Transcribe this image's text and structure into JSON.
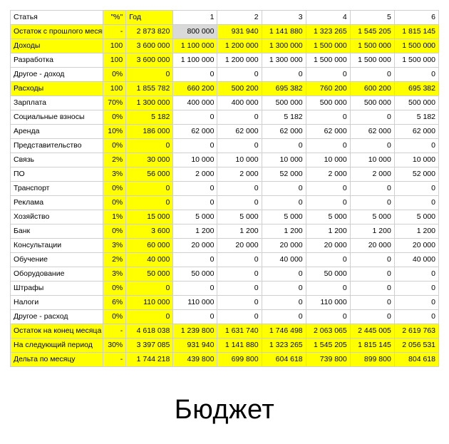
{
  "title": "Бюджет",
  "colors": {
    "highlight": "#ffff00",
    "selected_cell": "#d9d9d9",
    "grid_line": "#cfcfcf",
    "background": "#ffffff",
    "text": "#000000"
  },
  "table": {
    "columns": [
      {
        "key": "item",
        "label": "Статья",
        "align": "left"
      },
      {
        "key": "pct",
        "label": "\"%\"",
        "align": "right",
        "highlight": true
      },
      {
        "key": "year",
        "label": "Год",
        "align": "left",
        "highlight": true
      },
      {
        "key": "m1",
        "label": "1",
        "align": "right"
      },
      {
        "key": "m2",
        "label": "2",
        "align": "right"
      },
      {
        "key": "m3",
        "label": "3",
        "align": "right"
      },
      {
        "key": "m4",
        "label": "4",
        "align": "right"
      },
      {
        "key": "m5",
        "label": "5",
        "align": "right"
      },
      {
        "key": "m6",
        "label": "6",
        "align": "right"
      }
    ],
    "rows": [
      {
        "item": "Остаток с прошлого месяц",
        "pct": "-",
        "year": "2 873 820",
        "months": [
          "800 000",
          "931 940",
          "1 141 880",
          "1 323 265",
          "1 545 205",
          "1 815 145"
        ],
        "row_fill": "yellow",
        "month_fills": [
          "gray",
          "yellow",
          "yellow",
          "yellow",
          "yellow",
          "yellow"
        ]
      },
      {
        "item": "Доходы",
        "pct": "100",
        "year": "3 600 000",
        "months": [
          "1 100 000",
          "1 200 000",
          "1 300 000",
          "1 500 000",
          "1 500 000",
          "1 500 000"
        ],
        "row_fill": "yellow",
        "month_fills": [
          "yellow",
          "yellow",
          "yellow",
          "yellow",
          "yellow",
          "yellow"
        ]
      },
      {
        "item": "Разработка",
        "pct": "100",
        "year": "3 600 000",
        "months": [
          "1 100 000",
          "1 200 000",
          "1 300 000",
          "1 500 000",
          "1 500 000",
          "1 500 000"
        ],
        "row_fill": "white",
        "month_fills": [
          "white",
          "white",
          "white",
          "white",
          "white",
          "white"
        ]
      },
      {
        "item": "Другое - доход",
        "pct": "0%",
        "year": "0",
        "months": [
          "0",
          "0",
          "0",
          "0",
          "0",
          "0"
        ],
        "row_fill": "white",
        "month_fills": [
          "white",
          "white",
          "white",
          "white",
          "white",
          "white"
        ]
      },
      {
        "item": "Расходы",
        "pct": "100",
        "year": "1 855 782",
        "months": [
          "660 200",
          "500 200",
          "695 382",
          "760 200",
          "600 200",
          "695 382"
        ],
        "row_fill": "yellow",
        "month_fills": [
          "yellow",
          "yellow",
          "yellow",
          "yellow",
          "yellow",
          "yellow"
        ]
      },
      {
        "item": "Зарплата",
        "pct": "70%",
        "year": "1 300 000",
        "months": [
          "400 000",
          "400 000",
          "500 000",
          "500 000",
          "500 000",
          "500 000"
        ],
        "row_fill": "white",
        "month_fills": [
          "white",
          "white",
          "white",
          "white",
          "white",
          "white"
        ]
      },
      {
        "item": "Социальные взносы",
        "pct": "0%",
        "year": "5 182",
        "months": [
          "0",
          "0",
          "5 182",
          "0",
          "0",
          "5 182"
        ],
        "row_fill": "white",
        "month_fills": [
          "white",
          "white",
          "white",
          "white",
          "white",
          "white"
        ]
      },
      {
        "item": "Аренда",
        "pct": "10%",
        "year": "186 000",
        "months": [
          "62 000",
          "62 000",
          "62 000",
          "62 000",
          "62 000",
          "62 000"
        ],
        "row_fill": "white",
        "month_fills": [
          "white",
          "white",
          "white",
          "white",
          "white",
          "white"
        ]
      },
      {
        "item": "Представительство",
        "pct": "0%",
        "year": "0",
        "months": [
          "0",
          "0",
          "0",
          "0",
          "0",
          "0"
        ],
        "row_fill": "white",
        "month_fills": [
          "white",
          "white",
          "white",
          "white",
          "white",
          "white"
        ]
      },
      {
        "item": "Связь",
        "pct": "2%",
        "year": "30 000",
        "months": [
          "10 000",
          "10 000",
          "10 000",
          "10 000",
          "10 000",
          "10 000"
        ],
        "row_fill": "white",
        "month_fills": [
          "white",
          "white",
          "white",
          "white",
          "white",
          "white"
        ]
      },
      {
        "item": "ПО",
        "pct": "3%",
        "year": "56 000",
        "months": [
          "2 000",
          "2 000",
          "52 000",
          "2 000",
          "2 000",
          "52 000"
        ],
        "row_fill": "white",
        "month_fills": [
          "white",
          "white",
          "white",
          "white",
          "white",
          "white"
        ]
      },
      {
        "item": "Транспорт",
        "pct": "0%",
        "year": "0",
        "months": [
          "0",
          "0",
          "0",
          "0",
          "0",
          "0"
        ],
        "row_fill": "white",
        "month_fills": [
          "white",
          "white",
          "white",
          "white",
          "white",
          "white"
        ]
      },
      {
        "item": "Реклама",
        "pct": "0%",
        "year": "0",
        "months": [
          "0",
          "0",
          "0",
          "0",
          "0",
          "0"
        ],
        "row_fill": "white",
        "month_fills": [
          "white",
          "white",
          "white",
          "white",
          "white",
          "white"
        ]
      },
      {
        "item": "Хозяйство",
        "pct": "1%",
        "year": "15 000",
        "months": [
          "5 000",
          "5 000",
          "5 000",
          "5 000",
          "5 000",
          "5 000"
        ],
        "row_fill": "white",
        "month_fills": [
          "white",
          "white",
          "white",
          "white",
          "white",
          "white"
        ]
      },
      {
        "item": "Банк",
        "pct": "0%",
        "year": "3 600",
        "months": [
          "1 200",
          "1 200",
          "1 200",
          "1 200",
          "1 200",
          "1 200"
        ],
        "row_fill": "white",
        "month_fills": [
          "white",
          "white",
          "white",
          "white",
          "white",
          "white"
        ]
      },
      {
        "item": "Консультации",
        "pct": "3%",
        "year": "60 000",
        "months": [
          "20 000",
          "20 000",
          "20 000",
          "20 000",
          "20 000",
          "20 000"
        ],
        "row_fill": "white",
        "month_fills": [
          "white",
          "white",
          "white",
          "white",
          "white",
          "white"
        ]
      },
      {
        "item": "Обучение",
        "pct": "2%",
        "year": "40 000",
        "months": [
          "0",
          "0",
          "40 000",
          "0",
          "0",
          "40 000"
        ],
        "row_fill": "white",
        "month_fills": [
          "white",
          "white",
          "white",
          "white",
          "white",
          "white"
        ]
      },
      {
        "item": "Оборудование",
        "pct": "3%",
        "year": "50 000",
        "months": [
          "50 000",
          "0",
          "0",
          "50 000",
          "0",
          "0"
        ],
        "row_fill": "white",
        "month_fills": [
          "white",
          "white",
          "white",
          "white",
          "white",
          "white"
        ]
      },
      {
        "item": "Штрафы",
        "pct": "0%",
        "year": "0",
        "months": [
          "0",
          "0",
          "0",
          "0",
          "0",
          "0"
        ],
        "row_fill": "white",
        "month_fills": [
          "white",
          "white",
          "white",
          "white",
          "white",
          "white"
        ]
      },
      {
        "item": "Налоги",
        "pct": "6%",
        "year": "110 000",
        "months": [
          "110 000",
          "0",
          "0",
          "110 000",
          "0",
          "0"
        ],
        "row_fill": "white",
        "month_fills": [
          "white",
          "white",
          "white",
          "white",
          "white",
          "white"
        ]
      },
      {
        "item": "Другое - расход",
        "pct": "0%",
        "year": "0",
        "months": [
          "0",
          "0",
          "0",
          "0",
          "0",
          "0"
        ],
        "row_fill": "white",
        "month_fills": [
          "white",
          "white",
          "white",
          "white",
          "white",
          "white"
        ]
      },
      {
        "item": "Остаток на конец месяца",
        "pct": "-",
        "year": "4 618 038",
        "months": [
          "1 239 800",
          "1 631 740",
          "1 746 498",
          "2 063 065",
          "2 445 005",
          "2 619 763"
        ],
        "row_fill": "yellow",
        "month_fills": [
          "yellow",
          "yellow",
          "yellow",
          "yellow",
          "yellow",
          "yellow"
        ]
      },
      {
        "item": "На следующий период",
        "pct": "30%",
        "year": "3 397 085",
        "months": [
          "931 940",
          "1 141 880",
          "1 323 265",
          "1 545 205",
          "1 815 145",
          "2 056 531"
        ],
        "row_fill": "yellow",
        "month_fills": [
          "yellow",
          "yellow",
          "yellow",
          "yellow",
          "yellow",
          "yellow"
        ]
      },
      {
        "item": "Дельта по месяцу",
        "pct": "-",
        "year": "1 744 218",
        "months": [
          "439 800",
          "699 800",
          "604 618",
          "739 800",
          "899 800",
          "804 618"
        ],
        "row_fill": "yellow",
        "month_fills": [
          "yellow",
          "yellow",
          "yellow",
          "yellow",
          "yellow",
          "yellow"
        ]
      }
    ]
  }
}
